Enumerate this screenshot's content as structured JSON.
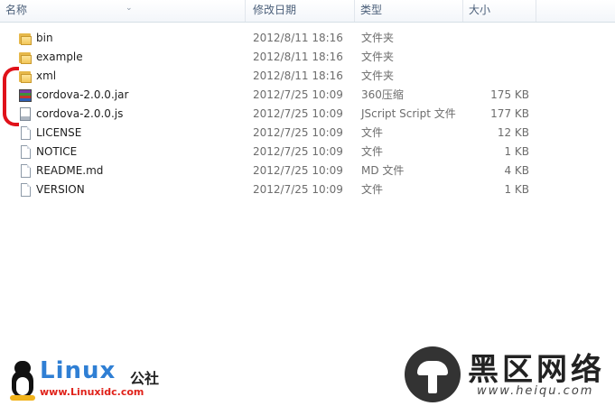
{
  "columns": {
    "name": "名称",
    "date": "修改日期",
    "type": "类型",
    "size": "大小"
  },
  "files": [
    {
      "name": "bin",
      "date": "2012/8/11 18:16",
      "type": "文件夹",
      "size": "",
      "icon": "folder-icon"
    },
    {
      "name": "example",
      "date": "2012/8/11 18:16",
      "type": "文件夹",
      "size": "",
      "icon": "folder-icon"
    },
    {
      "name": "xml",
      "date": "2012/8/11 18:16",
      "type": "文件夹",
      "size": "",
      "icon": "folder-icon"
    },
    {
      "name": "cordova-2.0.0.jar",
      "date": "2012/7/25 10:09",
      "type": "360压缩",
      "size": "175 KB",
      "icon": "archive-icon"
    },
    {
      "name": "cordova-2.0.0.js",
      "date": "2012/7/25 10:09",
      "type": "JScript Script 文件",
      "size": "177 KB",
      "icon": "script-file-icon"
    },
    {
      "name": "LICENSE",
      "date": "2012/7/25 10:09",
      "type": "文件",
      "size": "12 KB",
      "icon": "file-icon"
    },
    {
      "name": "NOTICE",
      "date": "2012/7/25 10:09",
      "type": "文件",
      "size": "1 KB",
      "icon": "file-icon"
    },
    {
      "name": "README.md",
      "date": "2012/7/25 10:09",
      "type": "MD 文件",
      "size": "4 KB",
      "icon": "file-icon"
    },
    {
      "name": "VERSION",
      "date": "2012/7/25 10:09",
      "type": "文件",
      "size": "1 KB",
      "icon": "file-icon"
    }
  ],
  "annotation_color": "#e0121a",
  "watermark_left": {
    "title": "Linux",
    "suffix": "公社",
    "url": "www.Linuxidc.com"
  },
  "watermark_right": {
    "title": "黑区网络",
    "url": "www.heiqu.com"
  }
}
